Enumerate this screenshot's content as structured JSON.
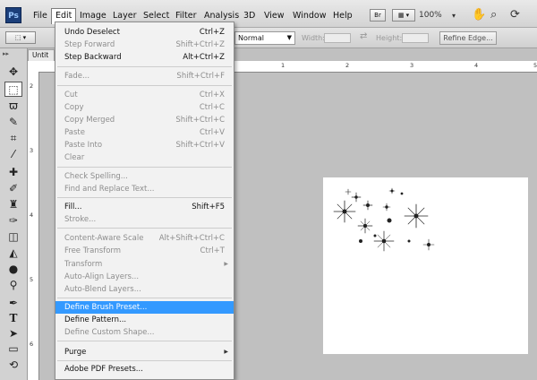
{
  "menubar": {
    "logo": "Ps",
    "items": [
      "File",
      "Edit",
      "Image",
      "Layer",
      "Select",
      "Filter",
      "Analysis",
      "3D",
      "View",
      "Window",
      "Help"
    ],
    "bridge_label": "Br",
    "zoom": "100%"
  },
  "options": {
    "style_value": "Normal",
    "width_label": "Width:",
    "height_label": "Height:",
    "refine_edge_label": "Refine Edge..."
  },
  "document": {
    "tab_label": "Untit"
  },
  "ruler": {
    "h_numbers": [
      "1",
      "2",
      "3",
      "4",
      "5"
    ],
    "v_numbers": [
      "2",
      "3",
      "4",
      "5",
      "6"
    ]
  },
  "edit_menu": {
    "items": [
      {
        "label": "Undo Deselect",
        "shortcut": "Ctrl+Z",
        "enabled": true
      },
      {
        "label": "Step Forward",
        "shortcut": "Shift+Ctrl+Z",
        "enabled": false
      },
      {
        "label": "Step Backward",
        "shortcut": "Alt+Ctrl+Z",
        "enabled": true
      },
      {
        "label": "Fade...",
        "shortcut": "Shift+Ctrl+F",
        "enabled": false
      },
      {
        "label": "Cut",
        "shortcut": "Ctrl+X",
        "enabled": false
      },
      {
        "label": "Copy",
        "shortcut": "Ctrl+C",
        "enabled": false
      },
      {
        "label": "Copy Merged",
        "shortcut": "Shift+Ctrl+C",
        "enabled": false
      },
      {
        "label": "Paste",
        "shortcut": "Ctrl+V",
        "enabled": false
      },
      {
        "label": "Paste Into",
        "shortcut": "Shift+Ctrl+V",
        "enabled": false
      },
      {
        "label": "Clear",
        "shortcut": "",
        "enabled": false
      },
      {
        "label": "Check Spelling...",
        "shortcut": "",
        "enabled": false
      },
      {
        "label": "Find and Replace Text...",
        "shortcut": "",
        "enabled": false
      },
      {
        "label": "Fill...",
        "shortcut": "Shift+F5",
        "enabled": true
      },
      {
        "label": "Stroke...",
        "shortcut": "",
        "enabled": false
      },
      {
        "label": "Content-Aware Scale",
        "shortcut": "Alt+Shift+Ctrl+C",
        "enabled": false
      },
      {
        "label": "Free Transform",
        "shortcut": "Ctrl+T",
        "enabled": false
      },
      {
        "label": "Transform",
        "shortcut": "",
        "enabled": false,
        "submenu": true
      },
      {
        "label": "Auto-Align Layers...",
        "shortcut": "",
        "enabled": false
      },
      {
        "label": "Auto-Blend Layers...",
        "shortcut": "",
        "enabled": false
      },
      {
        "label": "Define Brush Preset...",
        "shortcut": "",
        "enabled": true,
        "selected": true
      },
      {
        "label": "Define Pattern...",
        "shortcut": "",
        "enabled": true
      },
      {
        "label": "Define Custom Shape...",
        "shortcut": "",
        "enabled": false
      },
      {
        "label": "Purge",
        "shortcut": "",
        "enabled": true,
        "submenu": true
      },
      {
        "label": "Adobe PDF Presets...",
        "shortcut": "",
        "enabled": true
      }
    ]
  },
  "colors": {
    "highlight": "#3399ff",
    "logo_bg": "#1c3f7a"
  }
}
